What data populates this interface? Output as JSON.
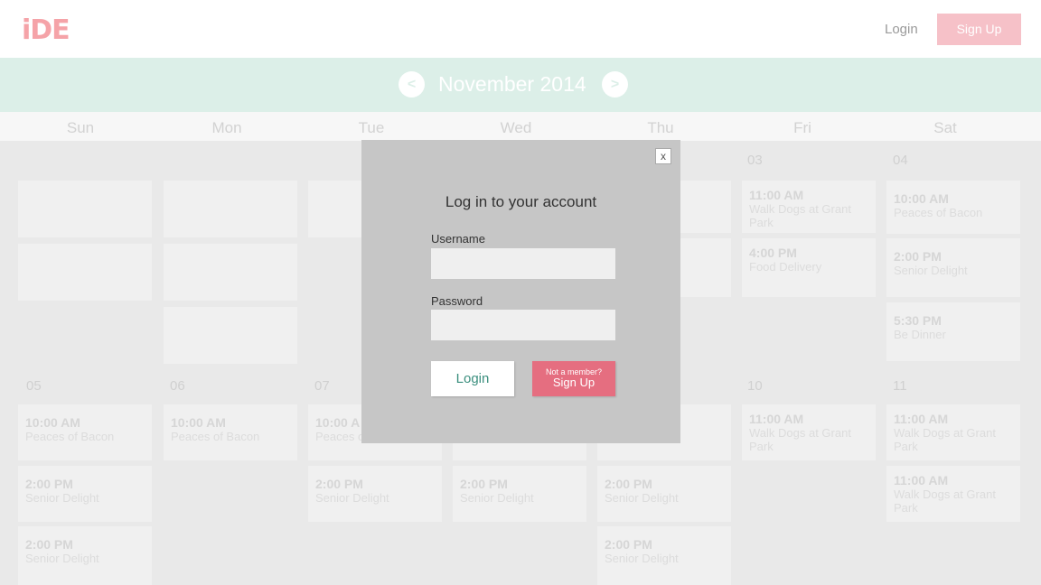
{
  "header": {
    "logo": "iDE",
    "login_label": "Login",
    "signup_label": "Sign Up"
  },
  "calendar": {
    "month_title": "November 2014",
    "prev_label": "<",
    "next_label": ">",
    "weekdays": [
      "Sun",
      "Mon",
      "Tue",
      "Wed",
      "Thu",
      "Fri",
      "Sat"
    ],
    "week1": {
      "days": [
        "03",
        "04"
      ],
      "fri_events": [
        {
          "time": "11:00 AM",
          "name": "Walk Dogs at Grant Park"
        },
        {
          "time": "4:00 PM",
          "name": "Food Delivery"
        }
      ],
      "sat_events": [
        {
          "time": "10:00 AM",
          "name": "Peaces of Bacon"
        },
        {
          "time": "2:00 PM",
          "name": "Senior Delight"
        },
        {
          "time": "5:30 PM",
          "name": "Be Dinner"
        }
      ]
    },
    "week2": {
      "days": [
        "05",
        "06",
        "07",
        "10",
        "11"
      ],
      "sun_events": [
        {
          "time": "10:00 AM",
          "name": "Peaces of Bacon"
        },
        {
          "time": "2:00 PM",
          "name": "Senior Delight"
        },
        {
          "time": "2:00 PM",
          "name": "Senior Delight"
        }
      ],
      "mon_events": [
        {
          "time": "10:00 AM",
          "name": "Peaces of Bacon"
        }
      ],
      "tue_events": [
        {
          "time": "10:00 A",
          "name": "Peaces of Bacon"
        },
        {
          "time": "2:00 PM",
          "name": "Senior Delight"
        }
      ],
      "wed_events": [
        {
          "time": "2:00 PM",
          "name": "Senior Delight"
        }
      ],
      "thu_events": [
        {
          "time": "2:00 PM",
          "name": "Senior Delight"
        },
        {
          "time": "2:00 PM",
          "name": "Senior Delight"
        }
      ],
      "fri_events": [
        {
          "time": "11:00 AM",
          "name": "Walk Dogs at Grant Park"
        }
      ],
      "sat_events": [
        {
          "time": "11:00 AM",
          "name": "Walk Dogs at Grant Park"
        },
        {
          "time": "11:00 AM",
          "name": "Walk Dogs at Grant Park"
        }
      ]
    }
  },
  "login_modal": {
    "close_label": "x",
    "title": "Log in to your account",
    "username_label": "Username",
    "username_value": "",
    "password_label": "Password",
    "password_value": "",
    "login_button": "Login",
    "member_question": "Not a member?",
    "member_signup": "Sign Up"
  }
}
